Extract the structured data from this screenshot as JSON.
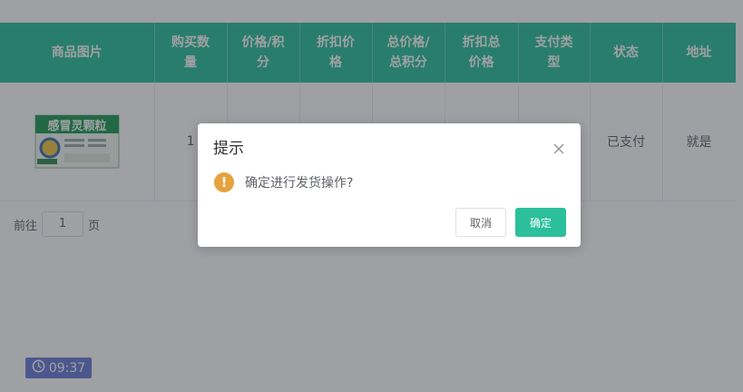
{
  "table": {
    "headers": [
      {
        "lines": [
          "商品图片"
        ]
      },
      {
        "lines": [
          "购买数",
          "量"
        ]
      },
      {
        "lines": [
          "价格/积",
          "分"
        ]
      },
      {
        "lines": [
          "折扣价",
          "格"
        ]
      },
      {
        "lines": [
          "总价格/",
          "总积分"
        ]
      },
      {
        "lines": [
          "折扣总",
          "价格"
        ]
      },
      {
        "lines": [
          "支付类",
          "型"
        ]
      },
      {
        "lines": [
          "状态"
        ]
      },
      {
        "lines": [
          "地址"
        ]
      }
    ],
    "row": {
      "image_caption": "感冒灵颗粒",
      "quantity": "1",
      "status": "已支付",
      "address": "就是"
    },
    "colors": {
      "header_bg": "#2bbf9c",
      "header_text": "#ffffff"
    }
  },
  "pagination": {
    "goto_label": "前往",
    "page_value": "1",
    "page_suffix": "页"
  },
  "clock": {
    "time": "09:37",
    "icon": "clock-icon"
  },
  "dialog": {
    "title": "提示",
    "message": "确定进行发货操作?",
    "cancel_label": "取消",
    "confirm_label": "确定",
    "icon": "warning-icon",
    "colors": {
      "warning": "#e6a23c",
      "primary": "#2bbf9c"
    }
  }
}
